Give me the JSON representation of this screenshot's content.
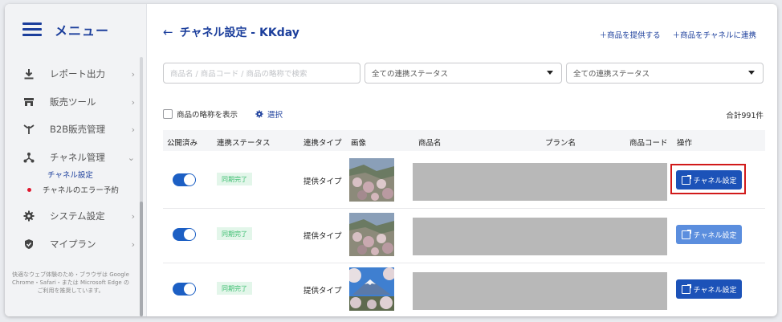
{
  "sidebar": {
    "menu_title": "メニュー",
    "items": [
      {
        "label": "レポート出力",
        "icon": "download-icon",
        "chevron": "›"
      },
      {
        "label": "販売ツール",
        "icon": "store-icon",
        "chevron": "›"
      },
      {
        "label": "B2B販売管理",
        "icon": "handshake-icon",
        "chevron": "›"
      },
      {
        "label": "チャネル管理",
        "icon": "hierarchy-icon",
        "chevron": "⌄"
      },
      {
        "label": "システム設定",
        "icon": "gear-icon",
        "chevron": "›"
      },
      {
        "label": "マイプラン",
        "icon": "shield-check-icon",
        "chevron": "›"
      }
    ],
    "sub_items": [
      "チャネル設定",
      "チャネルのエラー予約"
    ],
    "note": "快適なウェブ体験のため・ブラウザは Google Chrome・Safari・または Microsoft Edge のご利用を推奨しています。"
  },
  "header": {
    "back_arrow": "←",
    "title": "チャネル設定 - KKday",
    "links": [
      "＋商品を提供する",
      "＋商品をチャネルに連携"
    ]
  },
  "filters": {
    "search_placeholder": "商品名 / 商品コード / 商品の略称で検索",
    "status_select": "全ての連携ステータス",
    "status_select2": "全ての連携ステータス"
  },
  "options": {
    "show_abbrev": "商品の略称を表示",
    "select": "選択",
    "total": "合計991件"
  },
  "table": {
    "headers": [
      "公開済み",
      "連携ステータス",
      "連携タイプ",
      "画像",
      "商品名",
      "プラン名",
      "商品コード",
      "操作"
    ],
    "rows": [
      {
        "published": true,
        "status": "同期完了",
        "type": "提供タイプ",
        "action": "チャネル設定"
      },
      {
        "published": true,
        "status": "同期完了",
        "type": "提供タイプ",
        "action": "チャネル設定"
      },
      {
        "published": true,
        "status": "同期完了",
        "type": "提供タイプ",
        "action": "チャネル設定"
      }
    ]
  },
  "colors": {
    "accent": "#1c52b8",
    "highlight": "#d11a1a",
    "success_bg": "#e3f6ea",
    "success_text": "#3fbf72"
  }
}
